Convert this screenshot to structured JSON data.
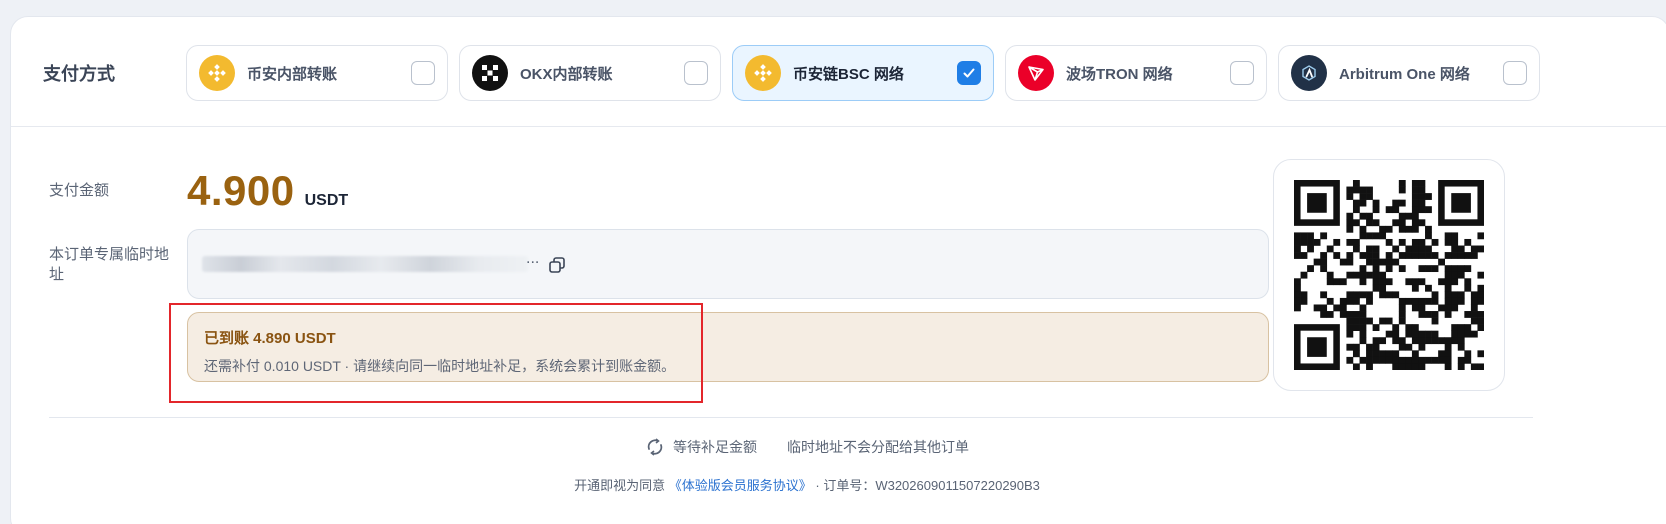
{
  "payment_methods": {
    "label": "支付方式",
    "options": [
      {
        "label": "币安内部转账",
        "icon": "binance-icon",
        "color": "#f3ba2f",
        "selected": false
      },
      {
        "label": "OKX内部转账",
        "icon": "okx-icon",
        "color": "#111111",
        "selected": false
      },
      {
        "label": "币安链BSC 网络",
        "icon": "bsc-icon",
        "color": "#f3ba2f",
        "selected": true
      },
      {
        "label": "波场TRON 网络",
        "icon": "tron-icon",
        "color": "#eb0029",
        "selected": false
      },
      {
        "label": "Arbitrum One 网络",
        "icon": "arbitrum-icon",
        "color": "#213147",
        "selected": false
      }
    ]
  },
  "payment": {
    "amount_label": "支付金额",
    "amount": "4.900",
    "currency": "USDT",
    "address_label": "本订单专属临时地址",
    "address_ellipsis": "..."
  },
  "notice": {
    "title": "已到账 4.890 USDT",
    "text": "还需补付 0.010 USDT · 请继续向同一临时地址补足，系统会累计到账金额。"
  },
  "status": {
    "waiting": "等待补足金额",
    "note": "临时地址不会分配给其他订单"
  },
  "footer": {
    "prefix": "开通即视为同意",
    "agreement": "《体验版会员服务协议》",
    "order_prefix": "· 订单号：",
    "order_no": "W3202609011507220290B3"
  },
  "colors": {
    "amount": "#9a6210",
    "selected_bg": "#eaf5ff",
    "check": "#1f7ee6",
    "highlight": "#e3262b"
  }
}
